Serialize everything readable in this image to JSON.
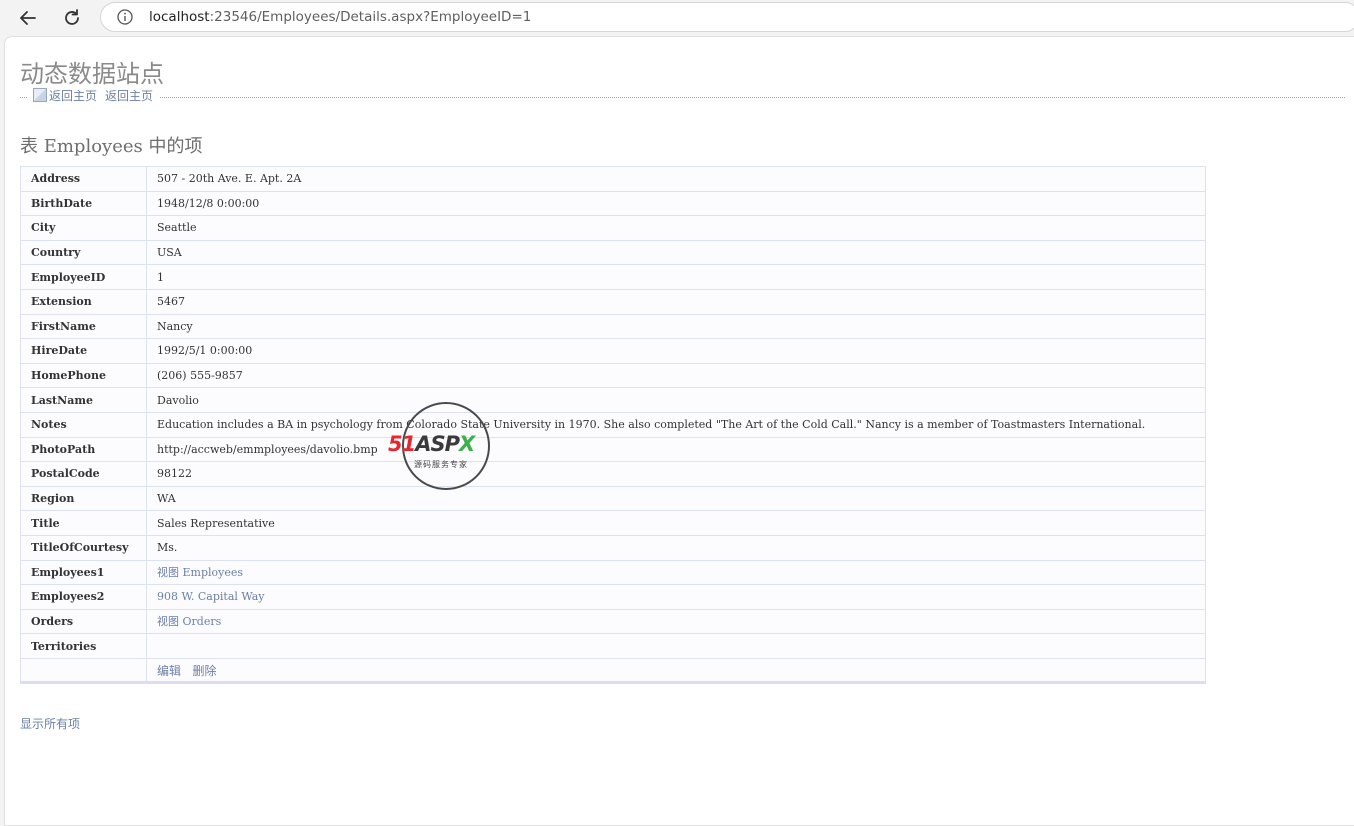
{
  "browser": {
    "url_host": "localhost",
    "url_rest": ":23546/Employees/Details.aspx?EmployeeID=1"
  },
  "page": {
    "site_title": "动态数据站点",
    "home_image_alt": "返回主页",
    "home_link": "返回主页",
    "section_title": "表 Employees 中的项",
    "show_all": "显示所有项"
  },
  "fields": [
    {
      "label": "Address",
      "value": "507 - 20th Ave. E. Apt. 2A"
    },
    {
      "label": "BirthDate",
      "value": "1948/12/8 0:00:00"
    },
    {
      "label": "City",
      "value": "Seattle"
    },
    {
      "label": "Country",
      "value": "USA"
    },
    {
      "label": "EmployeeID",
      "value": "1"
    },
    {
      "label": "Extension",
      "value": "5467"
    },
    {
      "label": "FirstName",
      "value": "Nancy"
    },
    {
      "label": "HireDate",
      "value": "1992/5/1 0:00:00"
    },
    {
      "label": "HomePhone",
      "value": "(206) 555-9857"
    },
    {
      "label": "LastName",
      "value": "Davolio"
    },
    {
      "label": "Notes",
      "value": "Education includes a BA in psychology from Colorado State University in 1970. She also completed \"The Art of the Cold Call.\" Nancy is a member of Toastmasters International."
    },
    {
      "label": "PhotoPath",
      "value": "http://accweb/emmployees/davolio.bmp"
    },
    {
      "label": "PostalCode",
      "value": "98122"
    },
    {
      "label": "Region",
      "value": "WA"
    },
    {
      "label": "Title",
      "value": "Sales Representative"
    },
    {
      "label": "TitleOfCourtesy",
      "value": "Ms."
    }
  ],
  "relations": {
    "employees1": {
      "label": "Employees1",
      "link": "视图 Employees"
    },
    "employees2": {
      "label": "Employees2",
      "link": "908 W. Capital Way"
    },
    "orders": {
      "label": "Orders",
      "link": "视图 Orders"
    },
    "territories": {
      "label": "Territories",
      "value": ""
    }
  },
  "commands": {
    "edit": "编辑",
    "delete": "删除"
  },
  "watermark": {
    "brand_51": "51",
    "brand_asp": "ASP",
    "brand_x": "X",
    "tagline": "源码服务专家"
  },
  "colors": {
    "link": "#6b7fa6",
    "title": "#8a8a8a",
    "border": "#dde3ee"
  },
  "icons": [
    "back-arrow-icon",
    "reload-icon",
    "info-icon",
    "broken-image-icon"
  ]
}
